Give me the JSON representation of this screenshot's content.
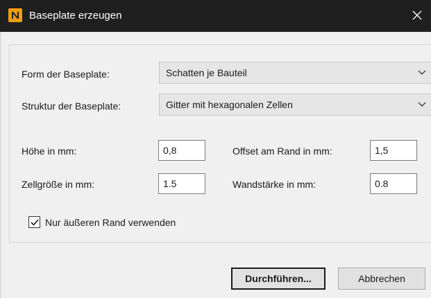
{
  "window": {
    "title": "Baseplate erzeugen",
    "app_icon": "N",
    "icon_color": "#f39c12"
  },
  "form": {
    "shape_label": "Form der Baseplate:",
    "shape_value": "Schatten je Bauteil",
    "structure_label": "Struktur der Baseplate:",
    "structure_value": "Gitter mit hexagonalen Zellen",
    "height_label": "Höhe in mm:",
    "height_value": "0,8",
    "offset_label": "Offset am Rand in mm:",
    "offset_value": "1,5",
    "cell_label": "Zellgröße in mm:",
    "cell_value": "1.5",
    "wall_label": "Wandstärke in mm:",
    "wall_value": "0.8",
    "outer_edge_label": "Nur äußeren Rand verwenden",
    "outer_edge_checked": true
  },
  "buttons": {
    "execute_label": "Durchführen...",
    "cancel_label": "Abbrechen"
  }
}
